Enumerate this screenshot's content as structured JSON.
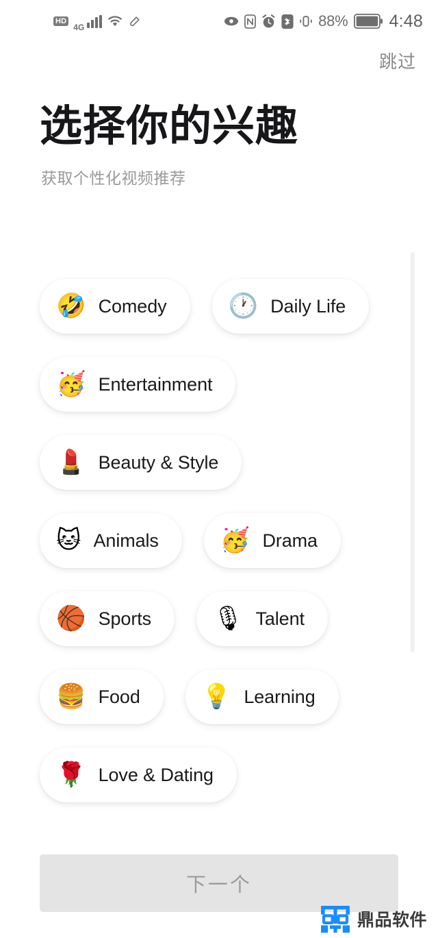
{
  "status_bar": {
    "hd_label": "HD",
    "network_label": "4G",
    "battery_percent": "88%",
    "time": "4:48",
    "icons": [
      "hd-badge-icon",
      "4g-icon",
      "signal-bars-icon",
      "wifi-icon",
      "link-icon",
      "eye-icon",
      "nfc-icon",
      "alarm-icon",
      "bluetooth-icon",
      "vibrate-icon",
      "battery-icon"
    ]
  },
  "header": {
    "skip_label": "跳过",
    "title": "选择你的兴趣",
    "subtitle": "获取个性化视频推荐"
  },
  "interests": [
    {
      "emoji": "🤣",
      "label": "Comedy",
      "icon": "rolling-on-the-floor-laughing-icon"
    },
    {
      "emoji": "🕐",
      "label": "Daily Life",
      "icon": "clock-icon"
    },
    {
      "emoji": "🥳",
      "label": "Entertainment",
      "icon": "partying-face-icon"
    },
    {
      "emoji": "💄",
      "label": "Beauty & Style",
      "icon": "lipstick-icon"
    },
    {
      "emoji": "🐱",
      "label": "Animals",
      "icon": "cat-face-icon"
    },
    {
      "emoji": "🥳",
      "label": "Drama",
      "icon": "partying-face-icon"
    },
    {
      "emoji": "🏀",
      "label": "Sports",
      "icon": "basketball-icon"
    },
    {
      "emoji": "🎙",
      "label": "Talent",
      "icon": "studio-microphone-icon"
    },
    {
      "emoji": "🍔",
      "label": "Food",
      "icon": "hamburger-icon"
    },
    {
      "emoji": "💡",
      "label": "Learning",
      "icon": "light-bulb-icon"
    },
    {
      "emoji": "🌹",
      "label": "Love & Dating",
      "icon": "rose-icon"
    }
  ],
  "footer": {
    "next_label": "下一个",
    "watermark_text": "鼎品软件",
    "watermark_color": "#1a8cff"
  },
  "colors": {
    "background": "#ffffff",
    "title": "#17171a",
    "subtitle": "#9a9a9e",
    "chip_background": "#ffffff",
    "chip_label": "#1a1a1d",
    "button_disabled_bg": "#e4e4e4",
    "button_disabled_text": "#9b9b9b",
    "skip_text": "#8a8a8a",
    "status_text": "#6e6e6e"
  }
}
